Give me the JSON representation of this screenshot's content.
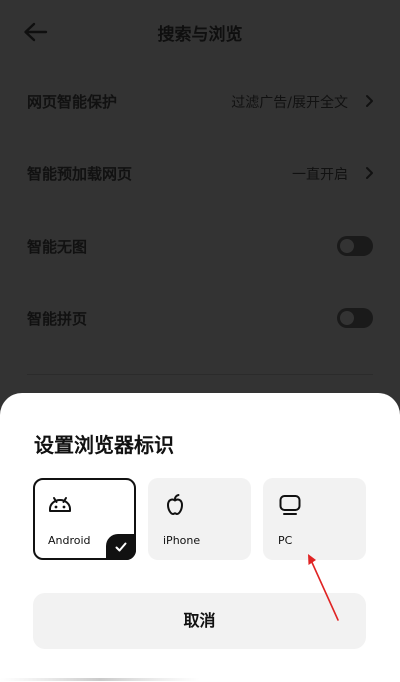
{
  "header": {
    "title": "搜索与浏览",
    "back_icon": "arrow-left-icon"
  },
  "settings": [
    {
      "label": "网页智能保护",
      "value": "过滤广告/展开全文",
      "control": "chevron"
    },
    {
      "label": "智能预加载网页",
      "value": "一直开启",
      "control": "chevron"
    },
    {
      "label": "智能无图",
      "control": "toggle",
      "on": false
    },
    {
      "label": "智能拼页",
      "control": "toggle",
      "on": false
    }
  ],
  "sheet": {
    "title": "设置浏览器标识",
    "options": [
      {
        "label": "Android",
        "icon": "android-icon",
        "selected": true
      },
      {
        "label": "iPhone",
        "icon": "apple-icon",
        "selected": false
      },
      {
        "label": "PC",
        "icon": "monitor-icon",
        "selected": false
      }
    ],
    "cancel_label": "取消"
  },
  "colors": {
    "dim_background": "#333333",
    "sheet_background": "#ffffff",
    "option_background": "#f2f2f2",
    "selected_border": "#111111",
    "annotation_arrow": "#e02424"
  }
}
